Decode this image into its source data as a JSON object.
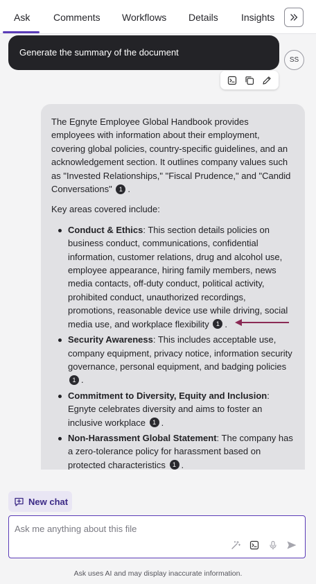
{
  "tabs": [
    {
      "label": "Ask",
      "active": true
    },
    {
      "label": "Comments"
    },
    {
      "label": "Workflows"
    },
    {
      "label": "Details"
    },
    {
      "label": "Insights"
    }
  ],
  "expand_icon": "double-chevron-right-icon",
  "prompt": {
    "text": "Generate the summary of the document",
    "avatar_initials": "SS",
    "actions": [
      "terminal-icon",
      "copy-icon",
      "pencil-icon"
    ]
  },
  "answer": {
    "intro": "The Egnyte Employee Global Handbook provides employees with information about their employment, covering global policies, country-specific guidelines, and an acknowledgement section. It outlines company values such as \"Invested Relationships,\" \"Fiscal Prudence,\" and \"Candid Conversations\"",
    "intro_cite": "1",
    "key_areas_label": "Key areas covered include:",
    "items": [
      {
        "title": "Conduct & Ethics",
        "text": ": This section details policies on business conduct, communications, confidential information, customer relations, drug and alcohol use, employee appearance, hiring family members, news media contacts, off-duty conduct, political activity, prohibited conduct, unauthorized recordings, promotions, reasonable device use while driving, social media use, and workplace flexibility",
        "cite": "1"
      },
      {
        "title": "Security Awareness",
        "text": ": This includes acceptable use, company equipment, privacy notice, information security governance, personal equipment, and badging policies",
        "cite": "1"
      },
      {
        "title": "Commitment to Diversity, Equity and Inclusion",
        "text": ": Egnyte celebrates diversity and aims to foster an inclusive workplace",
        "cite": "1"
      },
      {
        "title": "Non-Harassment Global Statement",
        "text": ": The company has a zero-tolerance policy for harassment based on protected characteristics",
        "cite": "1"
      }
    ],
    "period": ".",
    "arrow_color": "#8a2a55"
  },
  "new_chat": {
    "label": "New chat",
    "icon": "chat-plus-icon"
  },
  "ask": {
    "placeholder": "Ask me anything about this file",
    "tools": [
      "magic-wand-icon",
      "terminal-icon",
      "microphone-icon",
      "send-icon"
    ]
  },
  "disclaimer": "Ask uses AI and may display inaccurate information.",
  "colors": {
    "accent": "#5a3bb7",
    "prompt_bg": "#232327",
    "answer_bg": "#e1e1e4"
  }
}
